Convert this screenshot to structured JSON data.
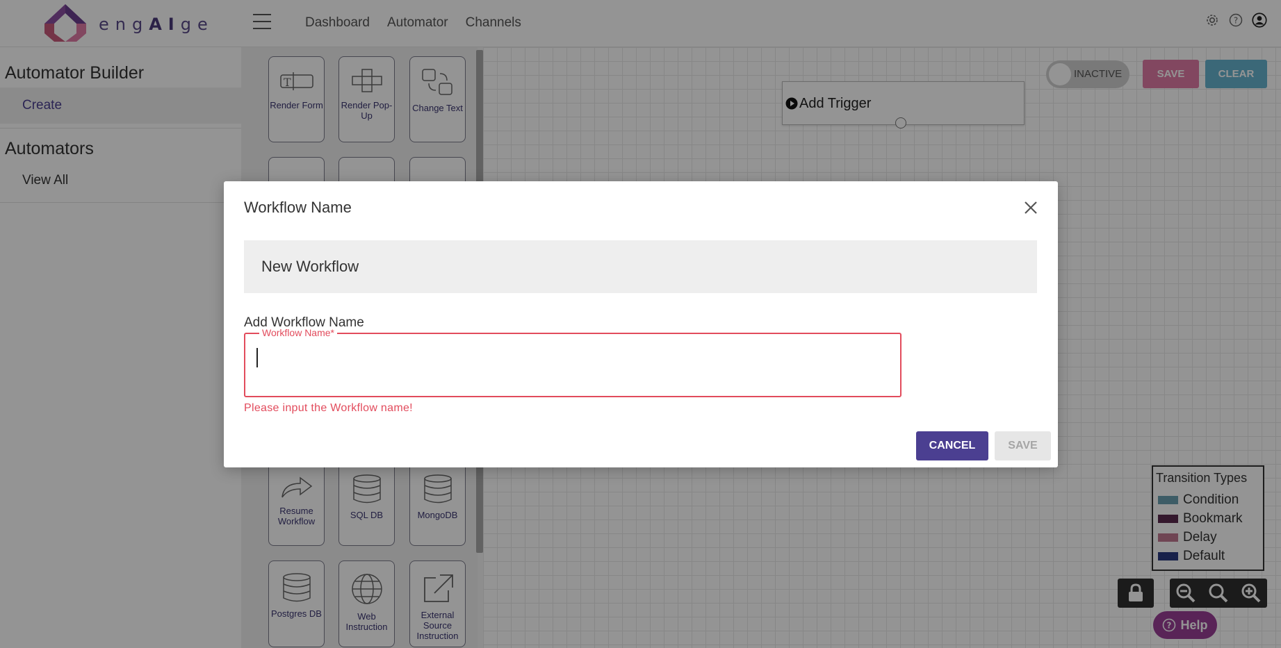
{
  "header": {
    "logo_text_a": "eng",
    "logo_text_b": "AI",
    "logo_text_c": "ge",
    "nav": [
      "Dashboard",
      "Automator",
      "Channels"
    ]
  },
  "sidebar": {
    "section1": "Automator Builder",
    "section1_item": "Create",
    "section2": "Automators",
    "section2_item": "View All"
  },
  "palette": {
    "tiles": [
      {
        "label": "Render Form",
        "icon": "form-icon"
      },
      {
        "label": "Render Pop-Up",
        "icon": "popup-icon"
      },
      {
        "label": "Change Text",
        "icon": "change-text-icon"
      },
      {
        "label": "Resume Workflow",
        "icon": "resume-icon"
      },
      {
        "label": "SQL DB",
        "icon": "database-icon"
      },
      {
        "label": "MongoDB",
        "icon": "database-icon"
      },
      {
        "label": "Postgres DB",
        "icon": "database-icon"
      },
      {
        "label": "Web Instruction",
        "icon": "globe-icon"
      },
      {
        "label": "External Source Instruction",
        "icon": "external-link-icon"
      }
    ]
  },
  "canvas": {
    "toggle_label": "INACTIVE",
    "save_label": "SAVE",
    "clear_label": "CLEAR",
    "trigger_label": "Add Trigger",
    "legend": {
      "title": "Transition Types",
      "items": [
        {
          "label": "Condition",
          "color": "#6a9fb0"
        },
        {
          "label": "Bookmark",
          "color": "#5a2a4e"
        },
        {
          "label": "Delay",
          "color": "#c0788f"
        },
        {
          "label": "Default",
          "color": "#2a3a80"
        }
      ]
    },
    "help_label": "Help"
  },
  "modal": {
    "title": "Workflow Name",
    "current_name": "New Workflow",
    "sub_label": "Add Workflow Name",
    "field_legend": "Workflow Name*",
    "field_value": "",
    "error": "Please input the Workflow name!",
    "cancel_label": "CANCEL",
    "save_label": "SAVE"
  },
  "colors": {
    "primary": "#4b3f91",
    "save_pink": "#e07aa5",
    "clear_blue": "#67b3cf",
    "error_red": "#e24b5c",
    "help_purple": "#9a3f96"
  }
}
